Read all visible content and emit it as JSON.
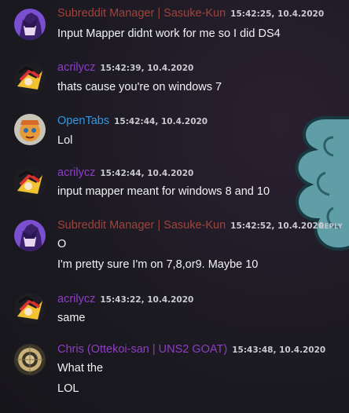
{
  "colors": {
    "subreddit_manager": "#a1433b",
    "acrilycz": "#8e3ec4",
    "opentabs": "#2d98e6",
    "chris": "#8e3ec4",
    "message_text": "#f2f2f4",
    "timestamp": "#c9c9cf"
  },
  "messages": [
    {
      "author": "Subreddit Manager | Sasuke-Kun",
      "timestamp": "15:42:25, 10.4.2020",
      "lines": [
        "Input Mapper didnt work for me so I did DS4"
      ]
    },
    {
      "author": "acrilycz",
      "timestamp": "15:42:39, 10.4.2020",
      "lines": [
        "thats cause you're on windows 7"
      ]
    },
    {
      "author": "OpenTabs",
      "timestamp": "15:42:44, 10.4.2020",
      "lines": [
        "Lol"
      ]
    },
    {
      "author": "acrilycz",
      "timestamp": "15:42:44, 10.4.2020",
      "lines": [
        "input mapper meant for windows 8 and 10"
      ]
    },
    {
      "author": "Subreddit Manager | Sasuke-Kun",
      "timestamp": "15:42:52, 10.4.2020",
      "reply_label": "REPLY",
      "lines": [
        "O",
        "I'm pretty sure I'm on 7,8,or9. Maybe 10"
      ]
    },
    {
      "author": "acrilycz",
      "timestamp": "15:43:22, 10.4.2020",
      "lines": [
        "same"
      ]
    },
    {
      "author": "Chris (Ottekoi-san | UNS2 GOAT)",
      "timestamp": "15:43:48, 10.4.2020",
      "lines": [
        "What the",
        "LOL"
      ]
    }
  ]
}
